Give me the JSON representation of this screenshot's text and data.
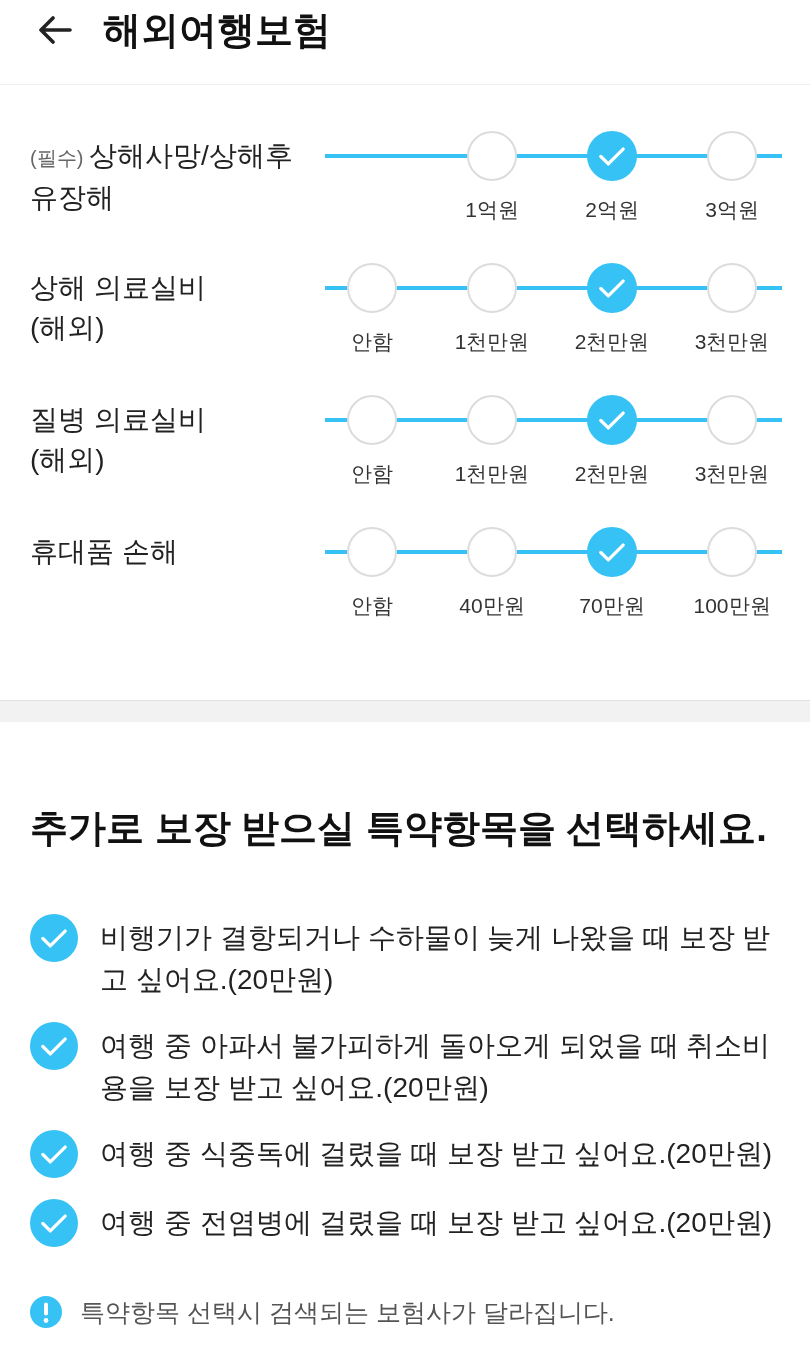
{
  "header": {
    "title": "해외여행보험"
  },
  "coverages": [
    {
      "tag": "(필수)",
      "label": "상해사망/상해후유장해",
      "options": [
        {
          "label": "1억원",
          "selected": false
        },
        {
          "label": "2억원",
          "selected": true
        },
        {
          "label": "3억원",
          "selected": false
        }
      ]
    },
    {
      "label": "상해 의료실비\n(해외)",
      "options": [
        {
          "label": "안함",
          "selected": false
        },
        {
          "label": "1천만원",
          "selected": false
        },
        {
          "label": "2천만원",
          "selected": true
        },
        {
          "label": "3천만원",
          "selected": false
        }
      ]
    },
    {
      "label": "질병 의료실비\n(해외)",
      "options": [
        {
          "label": "안함",
          "selected": false
        },
        {
          "label": "1천만원",
          "selected": false
        },
        {
          "label": "2천만원",
          "selected": true
        },
        {
          "label": "3천만원",
          "selected": false
        }
      ]
    },
    {
      "label": "휴대품 손해",
      "options": [
        {
          "label": "안함",
          "selected": false
        },
        {
          "label": "40만원",
          "selected": false
        },
        {
          "label": "70만원",
          "selected": true
        },
        {
          "label": "100만원",
          "selected": false
        }
      ]
    }
  ],
  "riders": {
    "heading": "추가로 보장 받으실 특약항목을 선택하세요.",
    "items": [
      {
        "text": "비행기가 결항되거나 수하물이 늦게 나왔을 때 보장 받고 싶어요.(20만원)",
        "checked": true
      },
      {
        "text": "여행 중 아파서 불가피하게 돌아오게 되었을 때 취소비용을 보장 받고 싶어요.(20만원)",
        "checked": true
      },
      {
        "text": "여행 중 식중독에 걸렸을 때 보장 받고 싶어요.(20만원)",
        "checked": true
      },
      {
        "text": "여행 중 전염병에 걸렸을 때 보장 받고 싶어요.(20만원)",
        "checked": true
      }
    ]
  },
  "notice": {
    "text": "특약항목 선택시 검색되는 보험사가 달라집니다."
  }
}
